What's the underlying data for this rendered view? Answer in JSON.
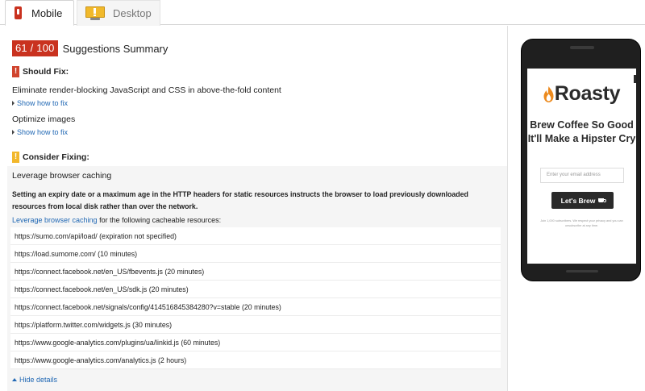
{
  "tabs": [
    {
      "label": "Mobile",
      "active": true
    },
    {
      "label": "Desktop",
      "active": false
    }
  ],
  "summary": {
    "score": "61 / 100",
    "title": "Suggestions Summary"
  },
  "should_fix": {
    "heading": "Should Fix:",
    "items": [
      {
        "title": "Eliminate render-blocking JavaScript and CSS in above-the-fold content",
        "link": "Show how to fix"
      },
      {
        "title": "Optimize images",
        "link": "Show how to fix"
      }
    ]
  },
  "consider_fixing": {
    "heading": "Consider Fixing:",
    "rule_title": "Leverage browser caching",
    "explanation": "Setting an expiry date or a maximum age in the HTTP headers for static resources instructs the browser to load previously downloaded resources from local disk rather than over the network.",
    "intro_link": "Leverage browser caching",
    "intro_rest": " for the following cacheable resources:",
    "resources": [
      "https://sumo.com/api/load/ (expiration not specified)",
      "https://load.sumome.com/ (10 minutes)",
      "https://connect.facebook.net/en_US/fbevents.js (20 minutes)",
      "https://connect.facebook.net/en_US/sdk.js (20 minutes)",
      "https://connect.facebook.net/signals/config/414516845384280?v=stable (20 minutes)",
      "https://platform.twitter.com/widgets.js (30 minutes)",
      "https://www.google-analytics.com/plugins/ua/linkid.js (60 minutes)",
      "https://www.google-analytics.com/analytics.js (2 hours)"
    ],
    "hide_link": "Hide details"
  },
  "preview": {
    "logo": "Roasty",
    "headline": "Brew Coffee So Good It'll Make a Hipster Cry",
    "email_placeholder": "Enter your email address",
    "button": "Let's Brew",
    "fine_print": "Join 1,000 subscribers. We respect your privacy and you can unsubscribe at any time."
  },
  "colors": {
    "score_red": "#c9321f",
    "warning_yellow": "#f2b72b",
    "link_blue": "#2168b4"
  }
}
